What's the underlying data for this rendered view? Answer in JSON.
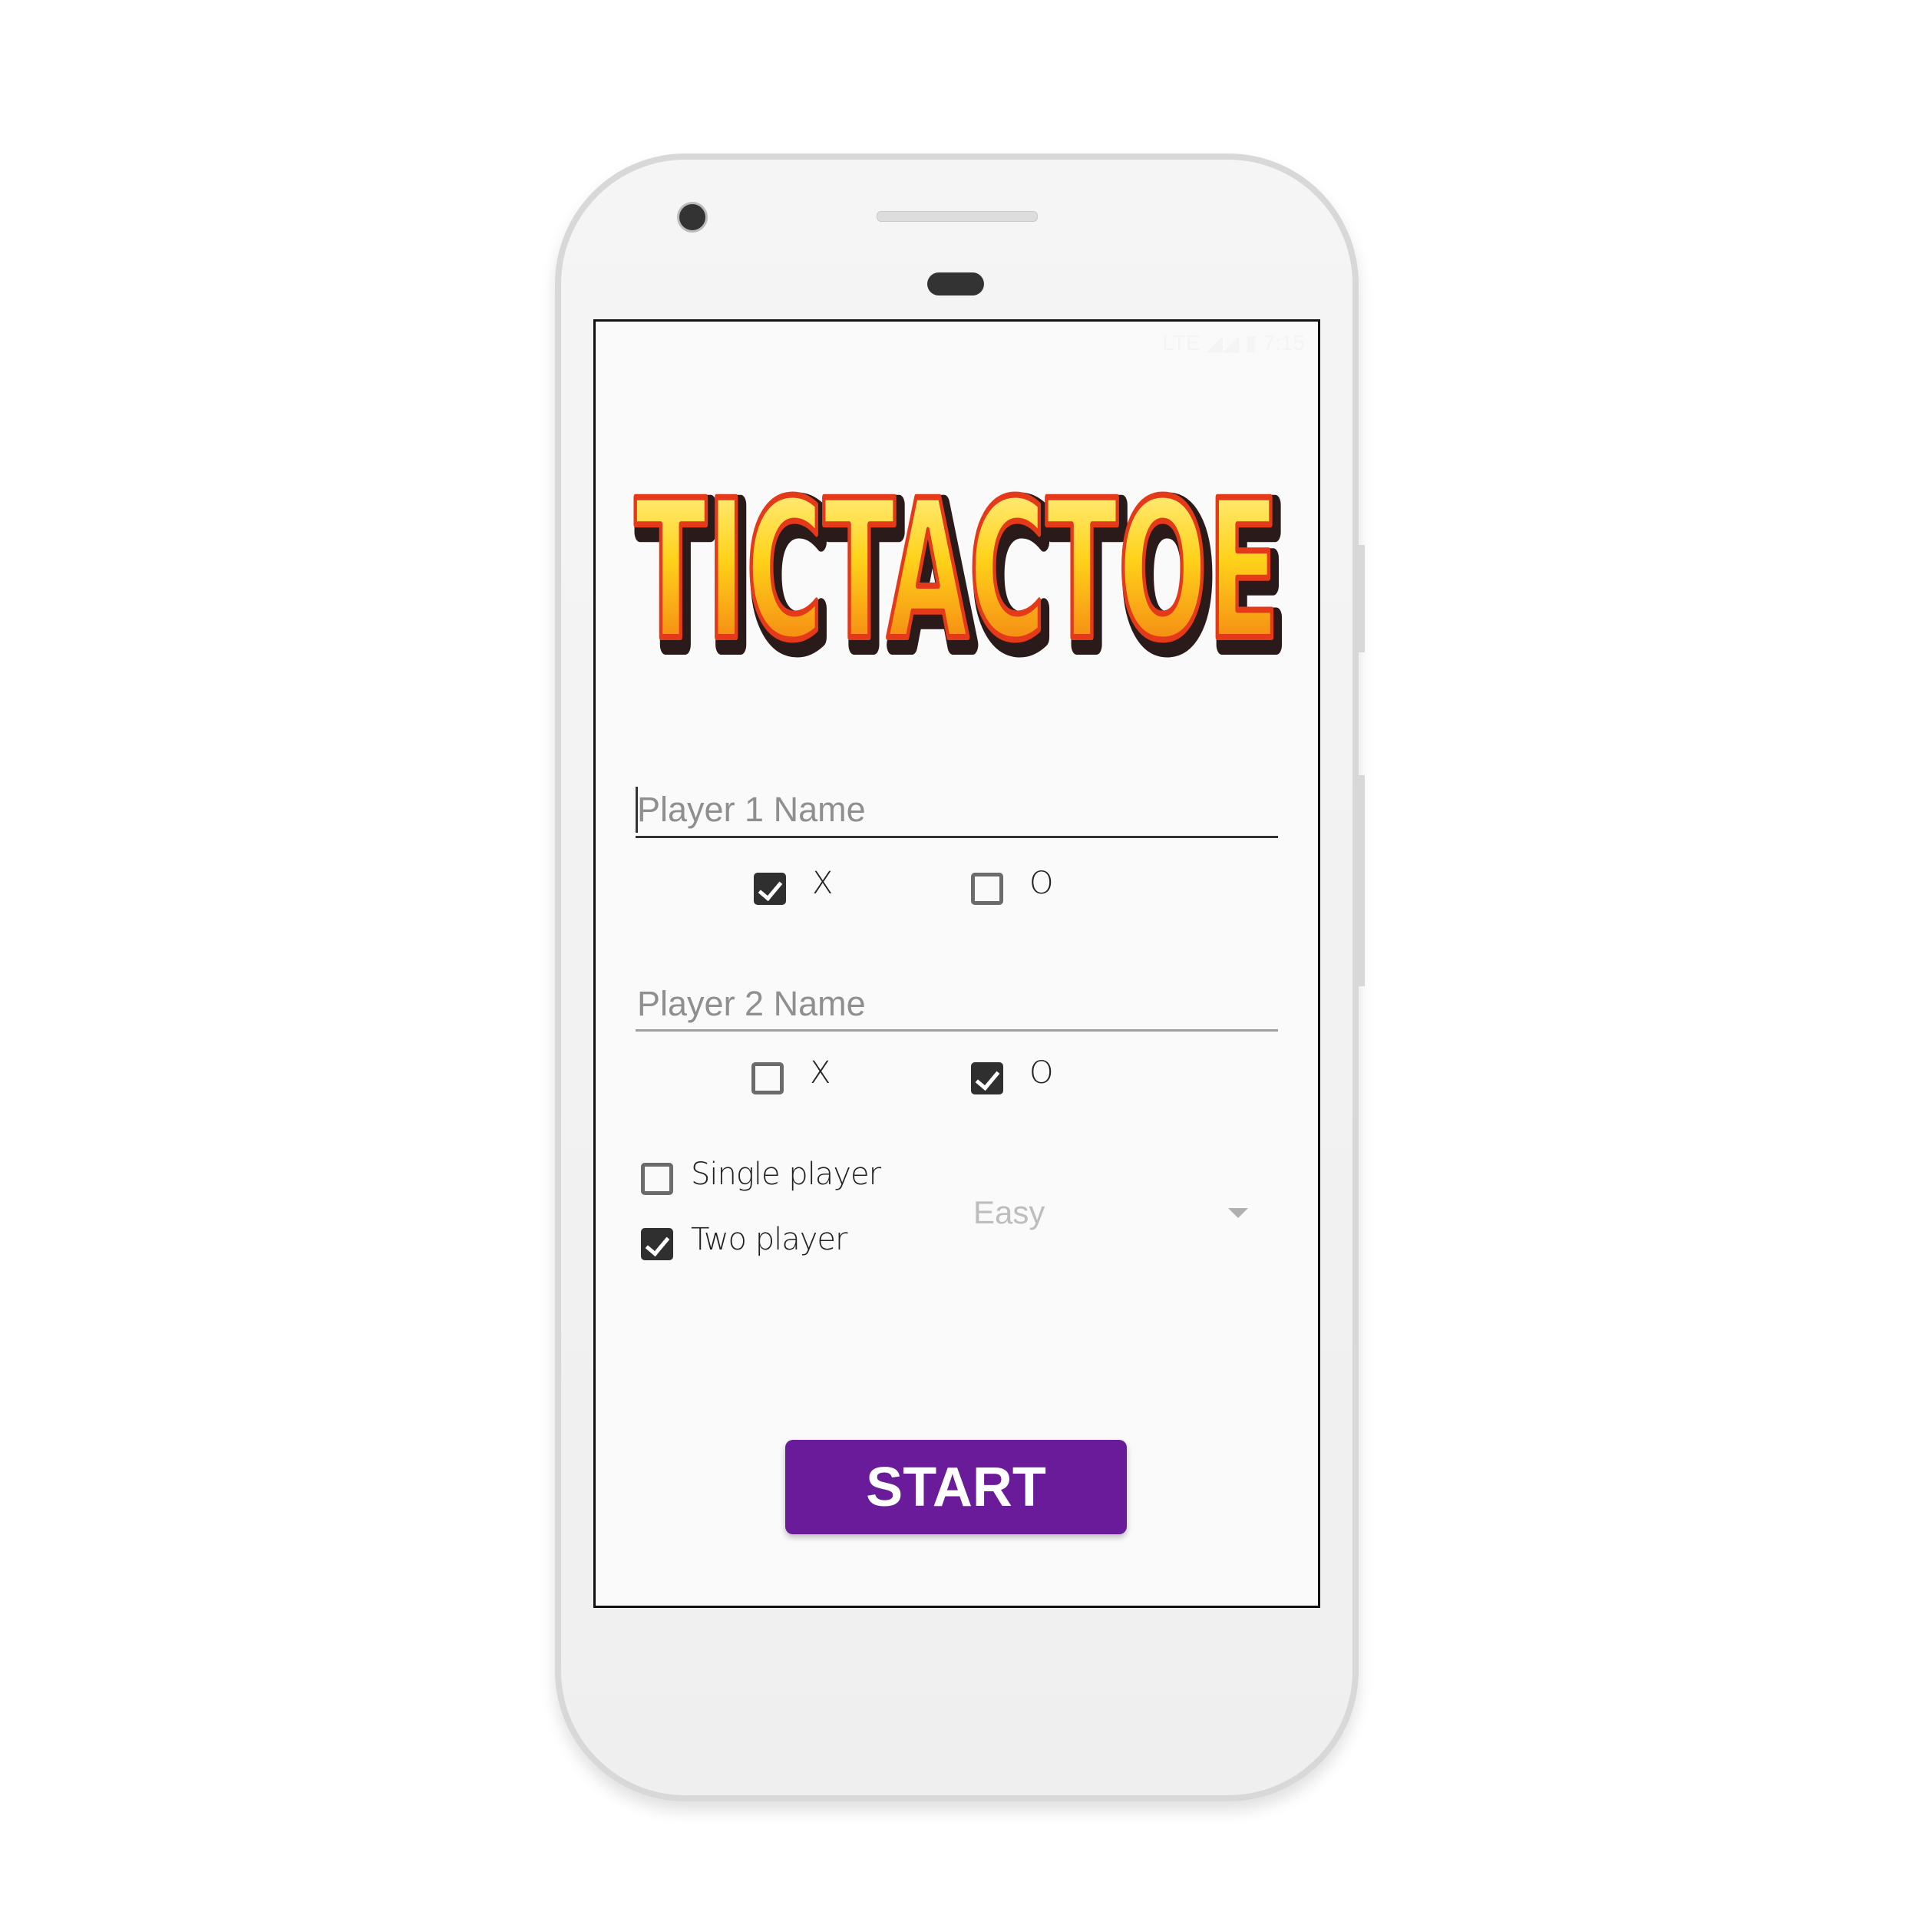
{
  "app": {
    "logo_text": "TICTACTOE"
  },
  "status_bar": {
    "time": "7:15",
    "network": "LTE"
  },
  "player1": {
    "placeholder": "Player 1 Name",
    "value": "",
    "options": [
      {
        "label": "X",
        "checked": true
      },
      {
        "label": "O",
        "checked": false
      }
    ]
  },
  "player2": {
    "placeholder": "Player 2 Name",
    "value": "",
    "options": [
      {
        "label": "X",
        "checked": false
      },
      {
        "label": "O",
        "checked": true
      }
    ]
  },
  "mode": {
    "options": [
      {
        "label": "Single player",
        "checked": false
      },
      {
        "label": "Two player",
        "checked": true
      }
    ]
  },
  "difficulty": {
    "selected": "Easy"
  },
  "start_button": {
    "label": "START"
  },
  "colors": {
    "accent": "#6a1b9a",
    "checkbox": "#2f2f2f"
  }
}
